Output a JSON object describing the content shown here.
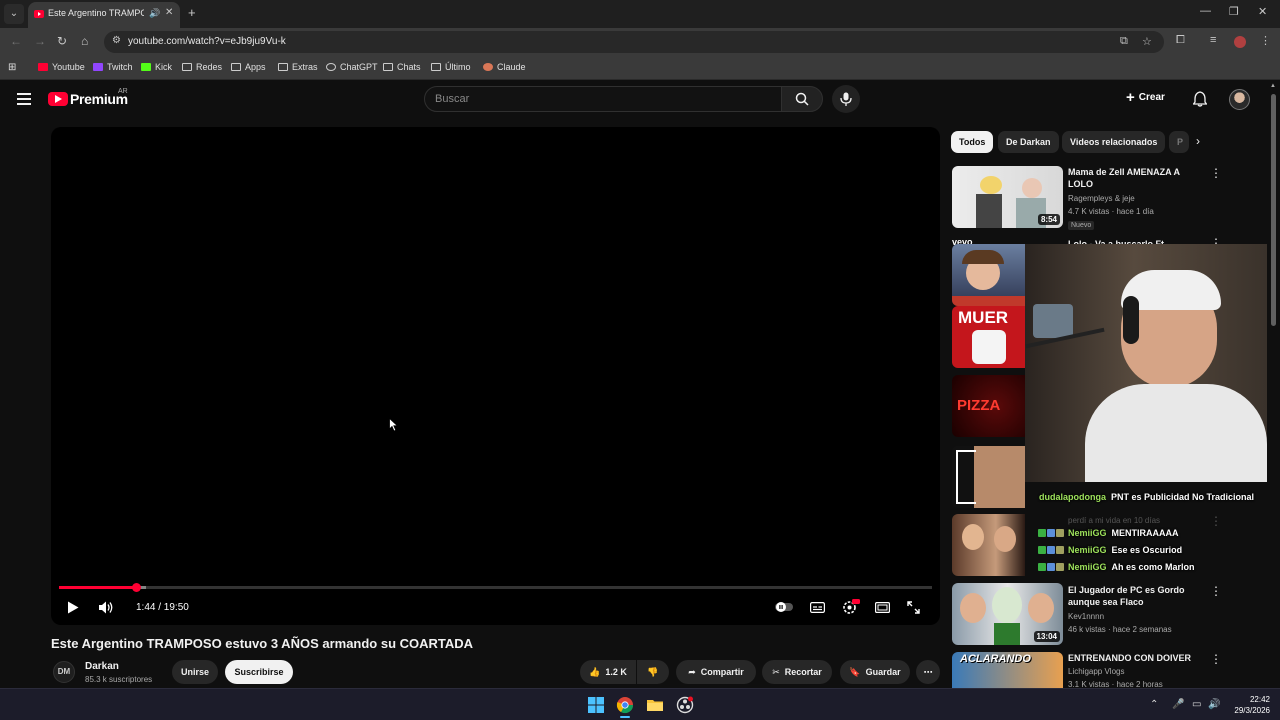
{
  "browser": {
    "tab_title": "Este Argentino TRAMPOSO",
    "url": "youtube.com/watch?v=eJb9ju9Vu-k",
    "bookmarks": [
      "Youtube",
      "Twitch",
      "Kick",
      "Redes",
      "Apps",
      "Extras",
      "ChatGPT",
      "Chats",
      "Último",
      "Claude"
    ]
  },
  "header": {
    "brand": "Premium",
    "country": "AR",
    "search_placeholder": "Buscar",
    "create_label": "Crear"
  },
  "player": {
    "current_time": "1:44 / 19:50",
    "progress_fraction": 0.088
  },
  "video": {
    "title": "Este Argentino TRAMPOSO estuvo 3 AÑOS armando su COARTADA",
    "channel_initials": "DM",
    "channel_name": "Darkan",
    "channel_subs": "85.3 k suscriptores",
    "join_label": "Unirse",
    "subscribe_label": "Suscribirse",
    "likes": "1.2 K",
    "share_label": "Compartir",
    "clip_label": "Recortar",
    "save_label": "Guardar"
  },
  "chips": [
    "Todos",
    "De Darkan",
    "Videos relacionados",
    "P"
  ],
  "related": [
    {
      "title": "Mama de Zell AMENAZA A LOLO",
      "channel": "Ragempleys & jeje",
      "meta": "4.7 K vistas · hace 1 día",
      "badge": "Nuevo",
      "duration": "8:54"
    },
    {
      "title": "Lolo - Va a buscarlo Ft",
      "channel": "",
      "meta": "",
      "badge": "",
      "duration": ""
    },
    {
      "title": "El Jugador de PC es Gordo aunque sea Flaco",
      "channel": "Kev1nnnn",
      "meta": "46 k vistas · hace 2 semanas",
      "badge": "",
      "duration": "13:04"
    },
    {
      "title": "ENTRENANDO CON DOIVER",
      "channel": "Lichigapp Vlogs",
      "meta": "3.1 K vistas · hace 2 horas",
      "badge": "",
      "duration": ""
    }
  ],
  "thumb_texts": {
    "vevo": "vevo",
    "muere": "MUER",
    "pizza": "PIZZA",
    "aclarando": "ACLARANDO",
    "partial_meta": "perdí a mi vida en 10 días"
  },
  "chat": [
    {
      "user": "dudalapodonga",
      "message": "PNT es Publicidad No Tradicional"
    },
    {
      "user": "NemiiGG",
      "message": "MENTIRAAAAA"
    },
    {
      "user": "NemiiGG",
      "message": "Ese es Oscuriod"
    },
    {
      "user": "NemiiGG",
      "message": "Ah es como Marlon"
    }
  ],
  "taskbar": {
    "time": "22:42",
    "date": "29/3/2026"
  },
  "colors": {
    "accent": "#ff0033",
    "background": "#0f0f0f",
    "chat_user": "#9ee25c"
  }
}
